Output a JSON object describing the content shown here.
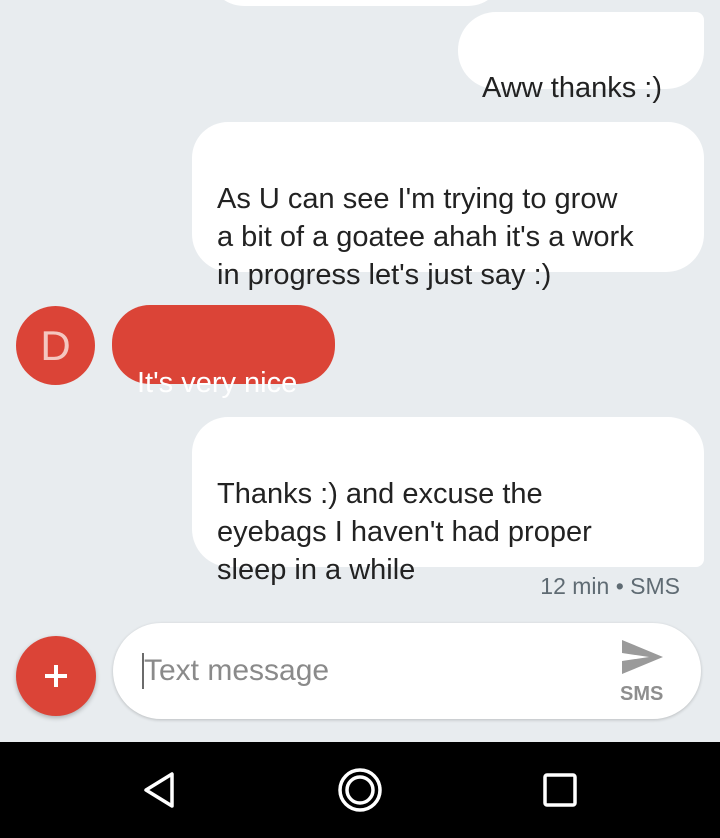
{
  "conversation": {
    "messages": [
      {
        "direction": "outgoing",
        "text": "Aww thanks :)"
      },
      {
        "direction": "outgoing",
        "text": "As U can see I'm trying to grow\na bit of a goatee ahah it's a work\nin progress let's just say :)"
      },
      {
        "direction": "incoming",
        "sender_initial": "D",
        "text": "It's very nice"
      },
      {
        "direction": "outgoing",
        "text": "Thanks :) and excuse the\neyebags I haven't had proper\nsleep in a while"
      }
    ],
    "last_meta": "12 min • SMS"
  },
  "composer": {
    "placeholder": "Text message",
    "send_type_label": "SMS",
    "add_icon": "plus-icon",
    "send_icon": "send-icon"
  },
  "navbar": {
    "back_icon": "back-triangle-icon",
    "home_icon": "home-circle-icon",
    "recents_icon": "recents-square-icon"
  },
  "colors": {
    "background": "#e8ecef",
    "outgoing_bubble": "#ffffff",
    "incoming_bubble": "#db4437",
    "accent": "#db4437",
    "navbar": "#000000"
  }
}
